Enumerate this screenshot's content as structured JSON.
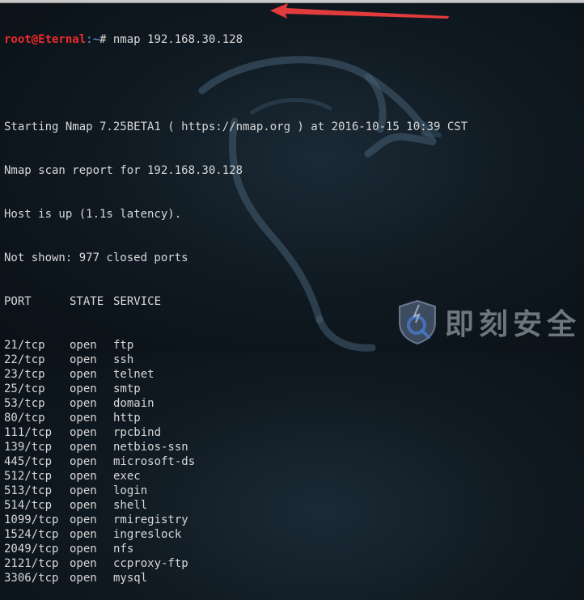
{
  "prompt": {
    "user_host": "root@Eternal",
    "path": ":~",
    "symbol": "#",
    "command": " nmap 192.168.30.128"
  },
  "output": {
    "start": "Starting Nmap 7.25BETA1 ( https://nmap.org ) at 2016-10-15 10:39 CST",
    "report": "Nmap scan report for 192.168.30.128",
    "host_status": "Host is up (1.1s latency).",
    "not_shown": "Not shown: 977 closed ports",
    "headers": {
      "port": "PORT",
      "state": "STATE",
      "service": "SERVICE"
    },
    "rows": [
      {
        "port": "21/tcp",
        "state": "open",
        "service": "ftp"
      },
      {
        "port": "22/tcp",
        "state": "open",
        "service": "ssh"
      },
      {
        "port": "23/tcp",
        "state": "open",
        "service": "telnet"
      },
      {
        "port": "25/tcp",
        "state": "open",
        "service": "smtp"
      },
      {
        "port": "53/tcp",
        "state": "open",
        "service": "domain"
      },
      {
        "port": "80/tcp",
        "state": "open",
        "service": "http"
      },
      {
        "port": "111/tcp",
        "state": "open",
        "service": "rpcbind"
      },
      {
        "port": "139/tcp",
        "state": "open",
        "service": "netbios-ssn"
      },
      {
        "port": "445/tcp",
        "state": "open",
        "service": "microsoft-ds"
      },
      {
        "port": "512/tcp",
        "state": "open",
        "service": "exec"
      },
      {
        "port": "513/tcp",
        "state": "open",
        "service": "login"
      },
      {
        "port": "514/tcp",
        "state": "open",
        "service": "shell"
      },
      {
        "port": "1099/tcp",
        "state": "open",
        "service": "rmiregistry"
      },
      {
        "port": "1524/tcp",
        "state": "open",
        "service": "ingreslock"
      },
      {
        "port": "2049/tcp",
        "state": "open",
        "service": "nfs"
      },
      {
        "port": "2121/tcp",
        "state": "open",
        "service": "ccproxy-ftp"
      },
      {
        "port": "3306/tcp",
        "state": "open",
        "service": "mysql"
      }
    ]
  },
  "watermark": {
    "text": "即刻安全",
    "icon": "shield-magnifier-logo"
  },
  "annotation": {
    "icon": "red-arrow-icon",
    "color": "#e23b3b"
  },
  "colors": {
    "background": "#101a22",
    "text": "#d8d8d8",
    "prompt_user": "#ee2a2a",
    "prompt_path": "#5ea0e8"
  }
}
